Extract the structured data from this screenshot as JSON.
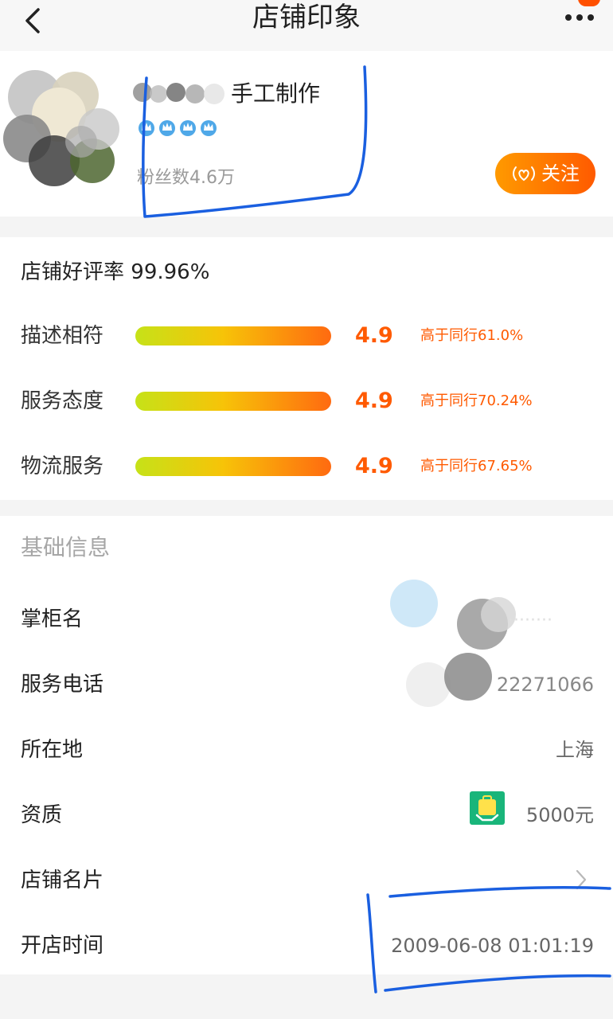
{
  "nav": {
    "title": "店铺印象"
  },
  "shop": {
    "name_visible": "手工制作",
    "fans_label": "粉丝数",
    "fans_value": "4.6万",
    "follow_label": "关注"
  },
  "ratings": {
    "good_rate_label": "店铺好评率",
    "good_rate_value": "99.96%",
    "items": [
      {
        "label": "描述相符",
        "score": "4.9",
        "compare": "高于同行61.0%"
      },
      {
        "label": "服务态度",
        "score": "4.9",
        "compare": "高于同行70.24%"
      },
      {
        "label": "物流服务",
        "score": "4.9",
        "compare": "高于同行67.65%"
      }
    ]
  },
  "info": {
    "title": "基础信息",
    "rows": [
      {
        "label": "掌柜名",
        "value": ""
      },
      {
        "label": "服务电话",
        "value": "22271066"
      },
      {
        "label": "所在地",
        "value": "上海"
      },
      {
        "label": "资质",
        "value": "5000元"
      },
      {
        "label": "店铺名片",
        "value": ""
      },
      {
        "label": "开店时间",
        "value": "2009-06-08 01:01:19"
      }
    ]
  },
  "colors": {
    "accent": "#ff5a00",
    "crown": "#4fa8e8",
    "cert_green": "#19b57a",
    "annotation_blue": "#1a5fe0"
  }
}
